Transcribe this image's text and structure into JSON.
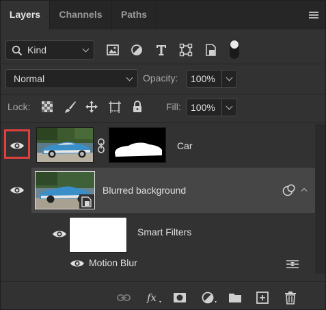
{
  "tabs": [
    {
      "label": "Layers",
      "active": true
    },
    {
      "label": "Channels",
      "active": false
    },
    {
      "label": "Paths",
      "active": false
    }
  ],
  "filter": {
    "kind_label": "Kind"
  },
  "blend": {
    "mode": "Normal",
    "opacity_label": "Opacity:",
    "opacity_value": "100%"
  },
  "lock": {
    "lock_label": "Lock:",
    "fill_label": "Fill:",
    "fill_value": "100%"
  },
  "layers": [
    {
      "name": "Car",
      "visible": true,
      "has_mask": true
    },
    {
      "name": "Blurred background",
      "visible": true,
      "smart_object": true,
      "selected": true
    },
    {
      "name": "Smart Filters",
      "visible": true
    },
    {
      "name": "Motion Blur",
      "visible": true
    }
  ],
  "colors": {
    "highlight": "#e0413f",
    "panel": "#323232",
    "selected_row": "#464646"
  }
}
